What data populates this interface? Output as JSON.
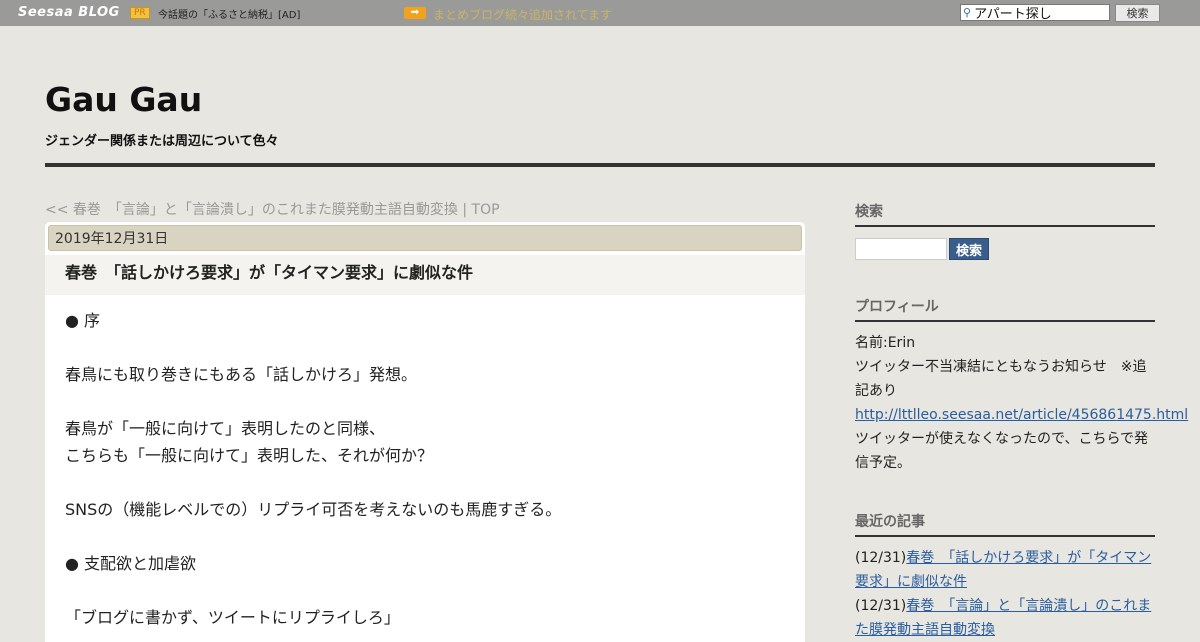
{
  "topbar": {
    "logo": "Seesaa BLOG",
    "pr_badge": "PR",
    "pr_text": "今話題の「ふるさと納税」[AD]",
    "arrow_glyph": "➡",
    "notice": "まとめブログ続々追加されてます",
    "search_value": "アパート探し",
    "search_button": "検索"
  },
  "header": {
    "title": "Gau Gau",
    "description": "ジェンダー関係または周辺について色々"
  },
  "breadcrumb": {
    "prev": "<< 春巻　「言論」と「言論潰し」のこれまた膜発動主語自動変換",
    "separator": " | ",
    "top": "TOP"
  },
  "article": {
    "date": "2019年12月31日",
    "title": "春巻　「話しかけろ要求」が「タイマン要求」に劇似な件",
    "lines": [
      "● 序",
      "",
      "春鳥にも取り巻きにもある「話しかけろ」発想。",
      "",
      "春鳥が「一般に向けて」表明したのと同様、",
      "こちらも「一般に向けて」表明した、それが何か？",
      "",
      "SNSの（機能レベルでの）リプライ可否を考えないのも馬鹿すぎる。",
      "",
      "● 支配欲と加虐欲",
      "",
      "「ブログに書かず、ツイートにリプライしろ」"
    ]
  },
  "sidebar": {
    "search": {
      "heading": "検索",
      "button": "検索"
    },
    "profile": {
      "heading": "プロフィール",
      "name": "名前:Erin",
      "notice": "ツイッター不当凍結にともなうお知らせ　※追記あり",
      "link": "http://lttlleo.seesaa.net/article/456861475.html",
      "note": "ツイッターが使えなくなったので、こちらで発信予定。"
    },
    "recent": {
      "heading": "最近の記事",
      "items": [
        {
          "date": "(12/31)",
          "title": "春巻　「話しかけろ要求」が「タイマン要求」に劇似な件"
        },
        {
          "date": "(12/31)",
          "title": "春巻　「言論」と「言論潰し」のこれまた膜発動主語自動変換"
        }
      ]
    }
  }
}
